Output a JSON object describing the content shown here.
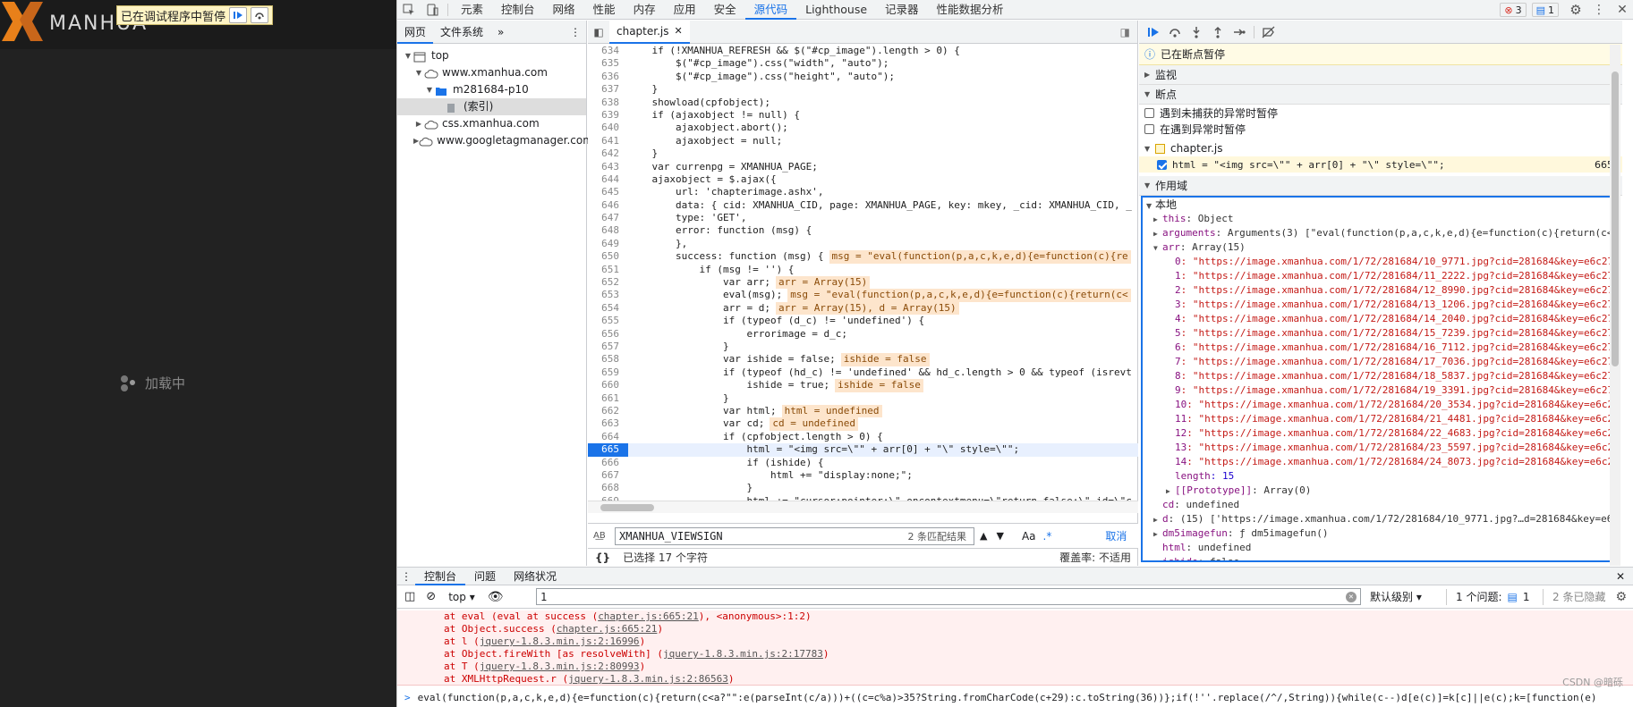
{
  "site": {
    "brand": "MANHUA",
    "paused_banner": "已在调试程序中暂停",
    "loading_text": "加载中"
  },
  "devtools_tabs": [
    "元素",
    "控制台",
    "网络",
    "性能",
    "内存",
    "应用",
    "安全",
    "源代码",
    "Lighthouse",
    "记录器",
    "性能数据分析"
  ],
  "active_tab": "源代码",
  "badges": {
    "errors": "3",
    "messages": "1"
  },
  "navigator": {
    "tabs": [
      "网页",
      "文件系统"
    ],
    "tree": [
      {
        "label": "top",
        "depth": 0,
        "icon": "frame-icon",
        "twisty": "▼"
      },
      {
        "label": "www.xmanhua.com",
        "depth": 1,
        "icon": "cloud-icon",
        "twisty": "▼"
      },
      {
        "label": "m281684-p10",
        "depth": 2,
        "icon": "folder-icon",
        "twisty": "▼"
      },
      {
        "label": "(索引)",
        "depth": 3,
        "icon": "file-icon",
        "twisty": "",
        "selected": true
      },
      {
        "label": "css.xmanhua.com",
        "depth": 1,
        "icon": "cloud-icon",
        "twisty": "▶"
      },
      {
        "label": "www.googletagmanager.com",
        "depth": 1,
        "icon": "cloud-icon",
        "twisty": "▶"
      }
    ]
  },
  "editor": {
    "file_tab": "chapter.js",
    "lines": [
      {
        "n": "634",
        "t": "    if (!XMANHUA_REFRESH && $(\"#cp_image\").length > 0) {"
      },
      {
        "n": "635",
        "t": "        $(\"#cp_image\").css(\"width\", \"auto\");"
      },
      {
        "n": "636",
        "t": "        $(\"#cp_image\").css(\"height\", \"auto\");"
      },
      {
        "n": "637",
        "t": "    }"
      },
      {
        "n": "638",
        "t": "    showload(cpfobject);"
      },
      {
        "n": "639",
        "t": "    if (ajaxobject != null) {"
      },
      {
        "n": "640",
        "t": "        ajaxobject.abort();"
      },
      {
        "n": "641",
        "t": "        ajaxobject = null;"
      },
      {
        "n": "642",
        "t": "    }"
      },
      {
        "n": "643",
        "t": "    var currenpg = XMANHUA_PAGE;"
      },
      {
        "n": "644",
        "t": "    ajaxobject = $.ajax({"
      },
      {
        "n": "645",
        "t": "        url: 'chapterimage.ashx',"
      },
      {
        "n": "646",
        "t": "        data: { cid: XMANHUA_CID, page: XMANHUA_PAGE, key: mkey, _cid: XMANHUA_CID, _"
      },
      {
        "n": "647",
        "t": "        type: 'GET',"
      },
      {
        "n": "648",
        "t": "        error: function (msg) {"
      },
      {
        "n": "649",
        "t": "        },"
      },
      {
        "n": "650",
        "t": "        success: function (msg) {",
        "v": "msg = \"eval(function(p,a,c,k,e,d){e=function(c){re"
      },
      {
        "n": "651",
        "t": "            if (msg != '') {"
      },
      {
        "n": "652",
        "t": "                var arr;",
        "v": "arr = Array(15)"
      },
      {
        "n": "653",
        "t": "                eval(msg);",
        "v": "msg = \"eval(function(p,a,c,k,e,d){e=function(c){return(c<"
      },
      {
        "n": "654",
        "t": "                arr = d;",
        "v": "arr = Array(15), d = Array(15)"
      },
      {
        "n": "655",
        "t": "                if (typeof (d_c) != 'undefined') {"
      },
      {
        "n": "656",
        "t": "                    errorimage = d_c;"
      },
      {
        "n": "657",
        "t": "                }"
      },
      {
        "n": "658",
        "t": "                var ishide = false;",
        "v": "ishide = false"
      },
      {
        "n": "659",
        "t": "                if (typeof (hd_c) != 'undefined' && hd_c.length > 0 && typeof (isrevt"
      },
      {
        "n": "660",
        "t": "                    ishide = true;",
        "v": "ishide = false"
      },
      {
        "n": "661",
        "t": "                }"
      },
      {
        "n": "662",
        "t": "                var html;",
        "v": "html = undefined"
      },
      {
        "n": "663",
        "t": "                var cd;",
        "v": "cd = undefined"
      },
      {
        "n": "664",
        "t": "                if (cpfobject.length > 0) {"
      },
      {
        "n": "665",
        "t": "                    html = \"<img src=\\\"\" + arr[0] + \"\\\" style=\\\"\";",
        "bp": true
      },
      {
        "n": "666",
        "t": "                    if (ishide) {"
      },
      {
        "n": "667",
        "t": "                        html += \"display:none;\";"
      },
      {
        "n": "668",
        "t": "                    }"
      },
      {
        "n": "669",
        "t": "                    html += \"cursor:pointer;\\\" oncontextmenu=\\\"return false;\\\" id=\\\"c"
      }
    ],
    "search_value": "XMANHUA_VIEWSIGN",
    "search_count": "2 条匹配结果",
    "match_case": "Aa",
    "regex": ".*",
    "cancel": "取消",
    "status_selected": "已选择 17 个字符",
    "coverage": "覆盖率: 不适用"
  },
  "debugger": {
    "paused_msg": "已在断点暂停",
    "sections": {
      "watch": "监视",
      "breakpoints": "断点",
      "scope": "作用域",
      "local": "本地"
    },
    "checkboxes": [
      "遇到未捕获的异常时暂停",
      "在遇到异常时暂停"
    ],
    "bp_file": "chapter.js",
    "bp_code": "html = \"<img src=\\\"\" + arr[0] + \"\\\" style=\\\"\";",
    "bp_line": "665",
    "scope_rows": [
      {
        "k": "this",
        "v": ": Object",
        "tw": "▶",
        "ind": 0
      },
      {
        "k": "arguments",
        "v": ": Arguments(3) [\"eval(function(p,a,c,k,e,d){e=function(c){return(c<a",
        "tw": "▶",
        "ind": 0
      },
      {
        "k": "arr",
        "v": ": Array(15)",
        "tw": "▼",
        "ind": 0
      },
      {
        "k": "0",
        "v": ": \"https://image.xmanhua.com/1/72/281684/10_9771.jpg?cid=281684&key=e6c27",
        "tw": "",
        "ind": 1,
        "s": true
      },
      {
        "k": "1",
        "v": ": \"https://image.xmanhua.com/1/72/281684/11_2222.jpg?cid=281684&key=e6c27",
        "tw": "",
        "ind": 1,
        "s": true
      },
      {
        "k": "2",
        "v": ": \"https://image.xmanhua.com/1/72/281684/12_8990.jpg?cid=281684&key=e6c27",
        "tw": "",
        "ind": 1,
        "s": true
      },
      {
        "k": "3",
        "v": ": \"https://image.xmanhua.com/1/72/281684/13_1206.jpg?cid=281684&key=e6c27",
        "tw": "",
        "ind": 1,
        "s": true
      },
      {
        "k": "4",
        "v": ": \"https://image.xmanhua.com/1/72/281684/14_2040.jpg?cid=281684&key=e6c27",
        "tw": "",
        "ind": 1,
        "s": true
      },
      {
        "k": "5",
        "v": ": \"https://image.xmanhua.com/1/72/281684/15_7239.jpg?cid=281684&key=e6c27",
        "tw": "",
        "ind": 1,
        "s": true
      },
      {
        "k": "6",
        "v": ": \"https://image.xmanhua.com/1/72/281684/16_7112.jpg?cid=281684&key=e6c27",
        "tw": "",
        "ind": 1,
        "s": true
      },
      {
        "k": "7",
        "v": ": \"https://image.xmanhua.com/1/72/281684/17_7036.jpg?cid=281684&key=e6c27",
        "tw": "",
        "ind": 1,
        "s": true
      },
      {
        "k": "8",
        "v": ": \"https://image.xmanhua.com/1/72/281684/18_5837.jpg?cid=281684&key=e6c27",
        "tw": "",
        "ind": 1,
        "s": true
      },
      {
        "k": "9",
        "v": ": \"https://image.xmanhua.com/1/72/281684/19_3391.jpg?cid=281684&key=e6c27",
        "tw": "",
        "ind": 1,
        "s": true
      },
      {
        "k": "10",
        "v": ": \"https://image.xmanhua.com/1/72/281684/20_3534.jpg?cid=281684&key=e6c2",
        "tw": "",
        "ind": 1,
        "s": true
      },
      {
        "k": "11",
        "v": ": \"https://image.xmanhua.com/1/72/281684/21_4481.jpg?cid=281684&key=e6c2",
        "tw": "",
        "ind": 1,
        "s": true
      },
      {
        "k": "12",
        "v": ": \"https://image.xmanhua.com/1/72/281684/22_4683.jpg?cid=281684&key=e6c2",
        "tw": "",
        "ind": 1,
        "s": true
      },
      {
        "k": "13",
        "v": ": \"https://image.xmanhua.com/1/72/281684/23_5597.jpg?cid=281684&key=e6c2",
        "tw": "",
        "ind": 1,
        "s": true
      },
      {
        "k": "14",
        "v": ": \"https://image.xmanhua.com/1/72/281684/24_8073.jpg?cid=281684&key=e6c2",
        "tw": "",
        "ind": 1,
        "s": true
      },
      {
        "k": "length",
        "v": ": 15",
        "tw": "",
        "ind": 1,
        "n": true
      },
      {
        "k": "[[Prototype]]",
        "v": ": Array(0)",
        "tw": "▶",
        "ind": 1
      },
      {
        "k": "cd",
        "v": ": undefined",
        "tw": "",
        "ind": 0
      },
      {
        "k": "d",
        "v": ": (15) ['https://image.xmanhua.com/1/72/281684/10_9771.jpg?…d=281684&key=e6",
        "tw": "▶",
        "ind": 0
      },
      {
        "k": "dm5imagefun",
        "v": ": ƒ dm5imagefun()",
        "tw": "▶",
        "ind": 0
      },
      {
        "k": "html",
        "v": ": undefined",
        "tw": "",
        "ind": 0
      },
      {
        "k": "ishide",
        "v": ": false",
        "tw": "",
        "ind": 0
      }
    ]
  },
  "drawer": {
    "tabs": [
      "控制台",
      "问题",
      "网络状况"
    ],
    "context": "top",
    "filter_value": "1",
    "level": "默认级别",
    "issues": "1 个问题:",
    "issues_count": "1",
    "hidden": "2 条已隐藏",
    "errors": [
      {
        "pre": "at eval (eval at success (",
        "link": "chapter.js:665:21",
        "post": "), <anonymous>:1:2)"
      },
      {
        "pre": "at Object.success (",
        "link": "chapter.js:665:21",
        "post": ")"
      },
      {
        "pre": "at l (",
        "link": "jquery-1.8.3.min.js:2:16996",
        "post": ")"
      },
      {
        "pre": "at Object.fireWith [as resolveWith] (",
        "link": "jquery-1.8.3.min.js:2:17783",
        "post": ")"
      },
      {
        "pre": "at T (",
        "link": "jquery-1.8.3.min.js:2:80993",
        "post": ")"
      },
      {
        "pre": "at XMLHttpRequest.r (",
        "link": "jquery-1.8.3.min.js:2:86563",
        "post": ")"
      }
    ],
    "prompt": "eval(function(p,a,c,k,e,d){e=function(c){return(c<a?\"\":e(parseInt(c/a)))+((c=c%a)>35?String.fromCharCode(c+29):c.toString(36))};if(!''.replace(/^/,String)){while(c--)d[e(c)]=k[c]||e(c);k=[function(e)",
    "watermark": "CSDN @暗砾"
  }
}
